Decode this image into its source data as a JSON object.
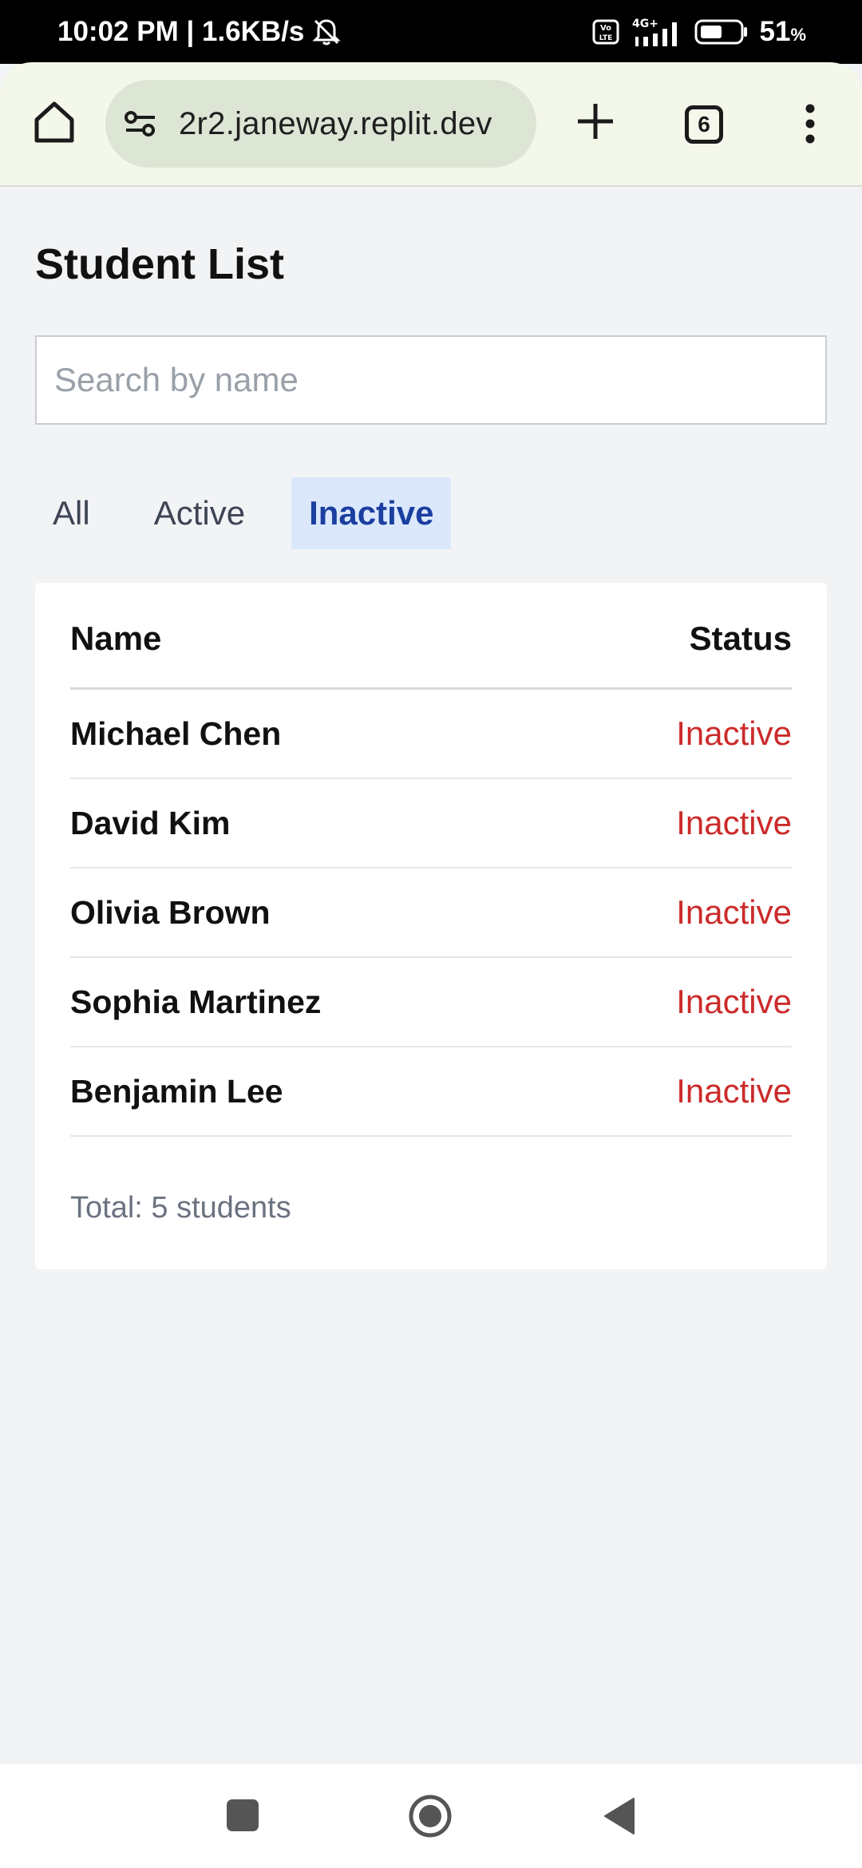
{
  "status_bar": {
    "time_speed": "10:02 PM | 1.6KB/s",
    "network": "4G+",
    "battery": "51",
    "battery_unit": "%"
  },
  "browser": {
    "url": "2r2.janeway.replit.dev",
    "tab_count": "6"
  },
  "page": {
    "title": "Student List",
    "search_placeholder": "Search by name",
    "filters": [
      {
        "label": "All",
        "active": false
      },
      {
        "label": "Active",
        "active": false
      },
      {
        "label": "Inactive",
        "active": true
      }
    ],
    "table": {
      "columns": [
        "Name",
        "Status"
      ],
      "rows": [
        {
          "name": "Michael Chen",
          "status": "Inactive"
        },
        {
          "name": "David Kim",
          "status": "Inactive"
        },
        {
          "name": "Olivia Brown",
          "status": "Inactive"
        },
        {
          "name": "Sophia Martinez",
          "status": "Inactive"
        },
        {
          "name": "Benjamin Lee",
          "status": "Inactive"
        }
      ]
    },
    "total": "Total: 5 students"
  },
  "colors": {
    "inactive_status": "#cc2a2a",
    "active_filter_bg": "#dbe8fc",
    "active_filter_text": "#1b3fa0"
  }
}
